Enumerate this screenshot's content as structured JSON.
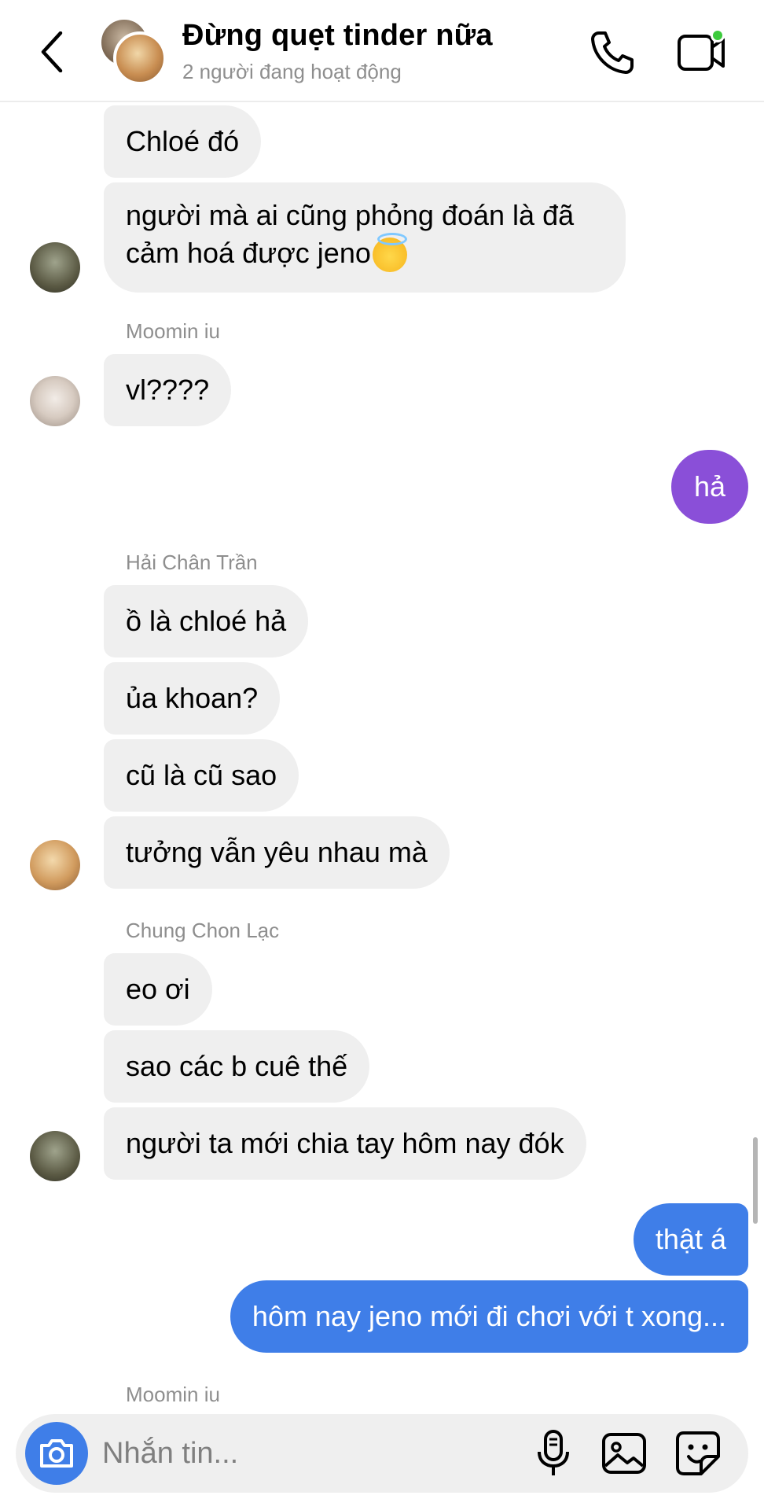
{
  "header": {
    "title": "Đừng quẹt tinder nữa",
    "subtitle": "2 người đang hoạt động"
  },
  "messages": {
    "m1": "Chloé đó",
    "m2_line1": "người mà ai cũng phỏng đoán là đã",
    "m2_line2": "cảm hoá được jeno",
    "sender1": "Moomin iu",
    "m3": "vl????",
    "m4": "hả",
    "sender2": "Hải Chân Trần",
    "m5": "ồ là chloé hả",
    "m6": "ủa khoan?",
    "m7": "cũ là cũ sao",
    "m8": "tưởng vẫn yêu nhau mà",
    "sender3": "Chung Chon Lạc",
    "m9": "eo ơi",
    "m10": "sao các b cuê thế",
    "m11": "người ta mới chia tay hôm nay đók",
    "m12": "thật á",
    "m13": "hôm nay jeno mới đi chơi với t xong...",
    "sender4": "Moomin iu"
  },
  "composer": {
    "placeholder": "Nhắn tin..."
  },
  "colors": {
    "incoming_bubble": "#efefef",
    "outgoing_purple": "#8a4fd8",
    "outgoing_blue": "#3f7ee8",
    "online": "#3dcb3d"
  },
  "icons": [
    "back-icon",
    "phone-icon",
    "video-call-icon",
    "camera-icon",
    "microphone-icon",
    "gallery-icon",
    "sticker-icon",
    "emoji-halo-icon"
  ]
}
